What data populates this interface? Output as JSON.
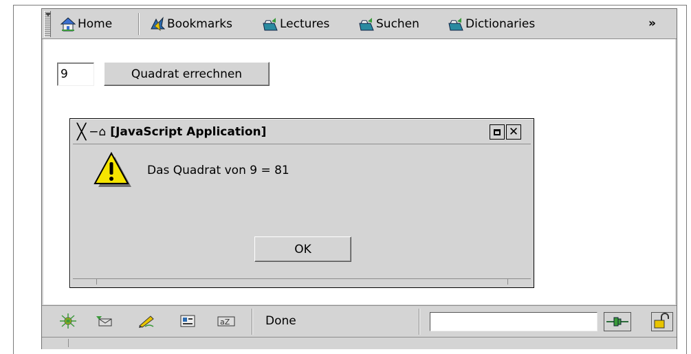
{
  "toolbar": {
    "items": [
      {
        "label": "Home",
        "icon": "home-icon"
      },
      {
        "label": "Bookmarks",
        "icon": "bookmarks-icon"
      },
      {
        "label": "Lectures",
        "icon": "folder-icon"
      },
      {
        "label": "Suchen",
        "icon": "folder-icon"
      },
      {
        "label": "Dictionaries",
        "icon": "folder-icon"
      }
    ],
    "overflow": "»"
  },
  "page": {
    "input_value": "9",
    "button_label": "Quadrat errechnen"
  },
  "dialog": {
    "title": "[JavaScript Application]",
    "message": "Das Quadrat von 9 = 81",
    "ok_label": "OK"
  },
  "statusbar": {
    "status_text": "Done",
    "icons": [
      "navigator-icon",
      "mail-icon",
      "composer-icon",
      "address-book-icon",
      "chat-icon",
      "online-plug-icon",
      "security-lock-icon"
    ]
  },
  "colors": {
    "chrome": "#d4d4d4",
    "warning_yellow": "#f5e400",
    "folder_teal": "#2a8aa0",
    "home_blue": "#3a6fd0"
  }
}
